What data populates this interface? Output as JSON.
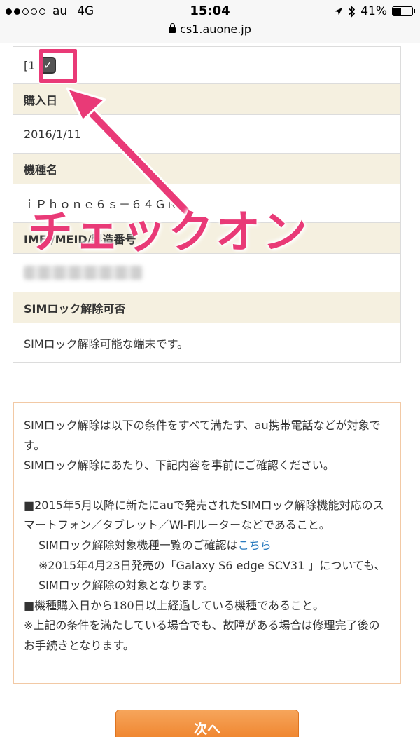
{
  "status_bar": {
    "carrier": "au",
    "network": "4G",
    "time": "15:04",
    "battery": "41%",
    "url": "cs1.auone.jp",
    "signal_bars_filled": 2,
    "signal_bars_total": 5,
    "battery_level": 0.41
  },
  "device_info": {
    "index_label": "[1",
    "checkbox_checked": true,
    "purchase_date_label": "購入日",
    "purchase_date": "2016/1/11",
    "model_label": "機種名",
    "model": "ｉＰｈｏｎｅ６ｓ－６４ＧＮ",
    "imei_label": "IMEI/MEID/製造番号",
    "simlock_label": "SIMロック解除可否",
    "simlock_value": "SIMロック解除可能な端末です。"
  },
  "annotation": {
    "text": "チェックオン",
    "color": "#e93a77"
  },
  "notice": {
    "line1": "SIMロック解除は以下の条件をすべて満たす、au携帯電話などが対象です。",
    "line2": "SIMロック解除にあたり、下記内容を事前にご確認ください。",
    "condition1": "■2015年5月以降に新たにauで発売されたSIMロック解除機能対応のスマートフォン／タブレット／Wi-Fiルーターなどであること。",
    "list_check_prefix": "SIMロック解除対象機種一覧のご確認は",
    "list_check_link": "こちら",
    "galaxy_note": "※2015年4月23日発売の「Galaxy S6 edge SCV31 」についても、SIMロック解除の対象となります。",
    "condition2": "■機種購入日から180日以上経過している機種であること。",
    "repair_note": "※上記の条件を満たしている場合でも、故障がある場合は修理完了後のお手続きとなります。"
  },
  "next_button": {
    "label": "次へ"
  },
  "colors": {
    "accent_pink": "#e93a77",
    "header_bg": "#f5f0e0",
    "notice_border": "#f2c9a5",
    "button_orange": "#ee7e25",
    "link_blue": "#2a7bbf"
  }
}
